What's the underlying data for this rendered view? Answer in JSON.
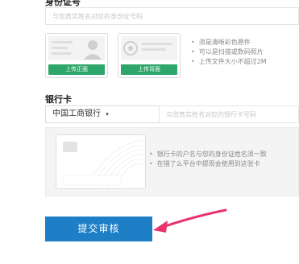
{
  "id_section": {
    "title": "身份证号",
    "placeholder": "与您真实姓名对应的身份证号码",
    "front_upload_label": "上传正面",
    "back_upload_label": "上传背面",
    "tips": [
      "须是清晰彩色原件",
      "可以是扫描或数码照片",
      "上传文件大小不超过2M"
    ]
  },
  "bank_section": {
    "title": "银行卡",
    "selected_bank": "中国工商银行",
    "placeholder": "与您真实姓名对应的银行卡号码",
    "tips": [
      "银行卡的户名与您的身份证姓名须一致",
      "在猎了么平台中提现会使用到这张卡"
    ]
  },
  "submit_label": "提交审核",
  "colors": {
    "upload_green": "#2ea66a",
    "submit_blue": "#1e7fc7",
    "arrow_pink": "#e8336d"
  }
}
